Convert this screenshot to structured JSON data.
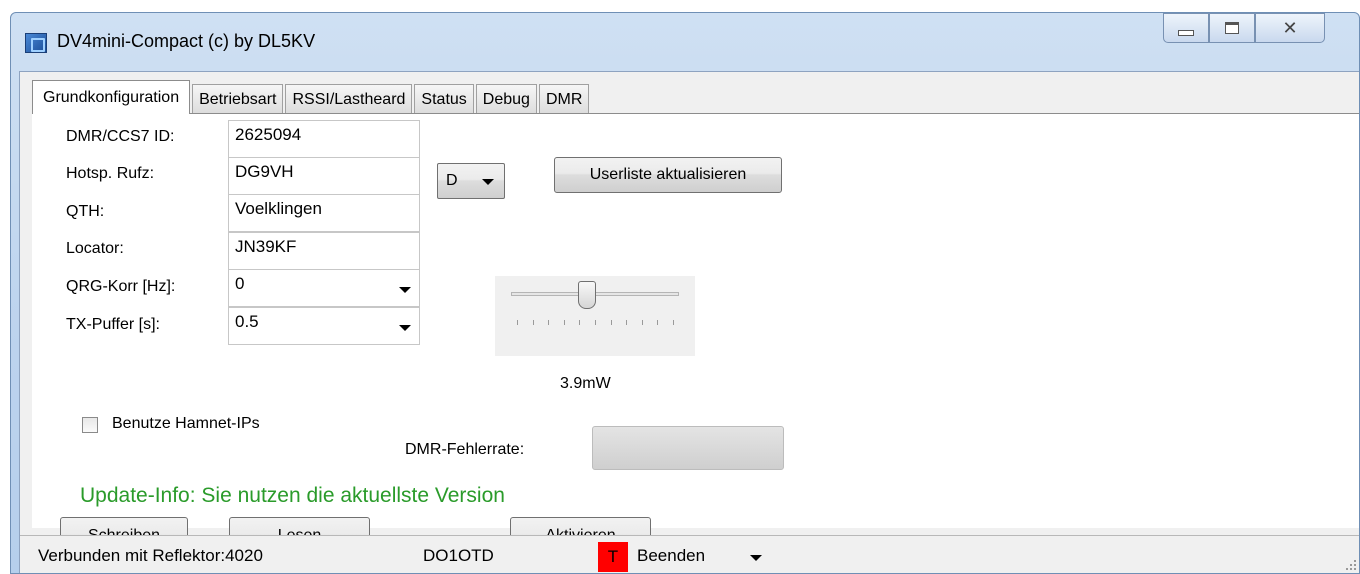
{
  "window": {
    "title": "DV4mini-Compact (c) by DL5KV",
    "minimize_glyph": "",
    "maximize_glyph": "",
    "close_glyph": "✕"
  },
  "tabs": [
    {
      "label": "Grundkonfiguration",
      "active": true
    },
    {
      "label": "Betriebsart"
    },
    {
      "label": "RSSI/Lastheard"
    },
    {
      "label": "Status"
    },
    {
      "label": "Debug"
    },
    {
      "label": "DMR"
    }
  ],
  "form": {
    "dmr_id_label": "DMR/CCS7 ID:",
    "dmr_id_value": "2625094",
    "callsign_label": "Hotsp. Rufz:",
    "callsign_value": "DG9VH",
    "callsign_suffix_value": "D",
    "qth_label": "QTH:",
    "qth_value": "Voelklingen",
    "locator_label": "Locator:",
    "locator_value": "JN39KF",
    "qrg_label": "QRG-Korr [Hz]:",
    "qrg_value": "0",
    "txbuf_label": "TX-Puffer [s]:",
    "txbuf_value": "0.5",
    "hamnet_label": "Benutze Hamnet-IPs",
    "hamnet_checked": false
  },
  "power": {
    "value_label": "3.9mW",
    "slider_fraction": 0.45
  },
  "buttons": {
    "userlist": "Userliste aktualisieren",
    "write": "Schreiben",
    "read": "Lesen",
    "activate": "Aktivieren"
  },
  "dmr_error": {
    "label": "DMR-Fehlerrate:",
    "fill_fraction": 0
  },
  "update_info": "Update-Info: Sie nutzen die aktuellste Version",
  "statusbar": {
    "connection": "Verbunden mit Reflektor:4020",
    "user": "DO1OTD",
    "badge": "T",
    "exit": "Beenden"
  },
  "colors": {
    "update_text": "#2a9b2a",
    "badge_bg": "#ff0000"
  }
}
